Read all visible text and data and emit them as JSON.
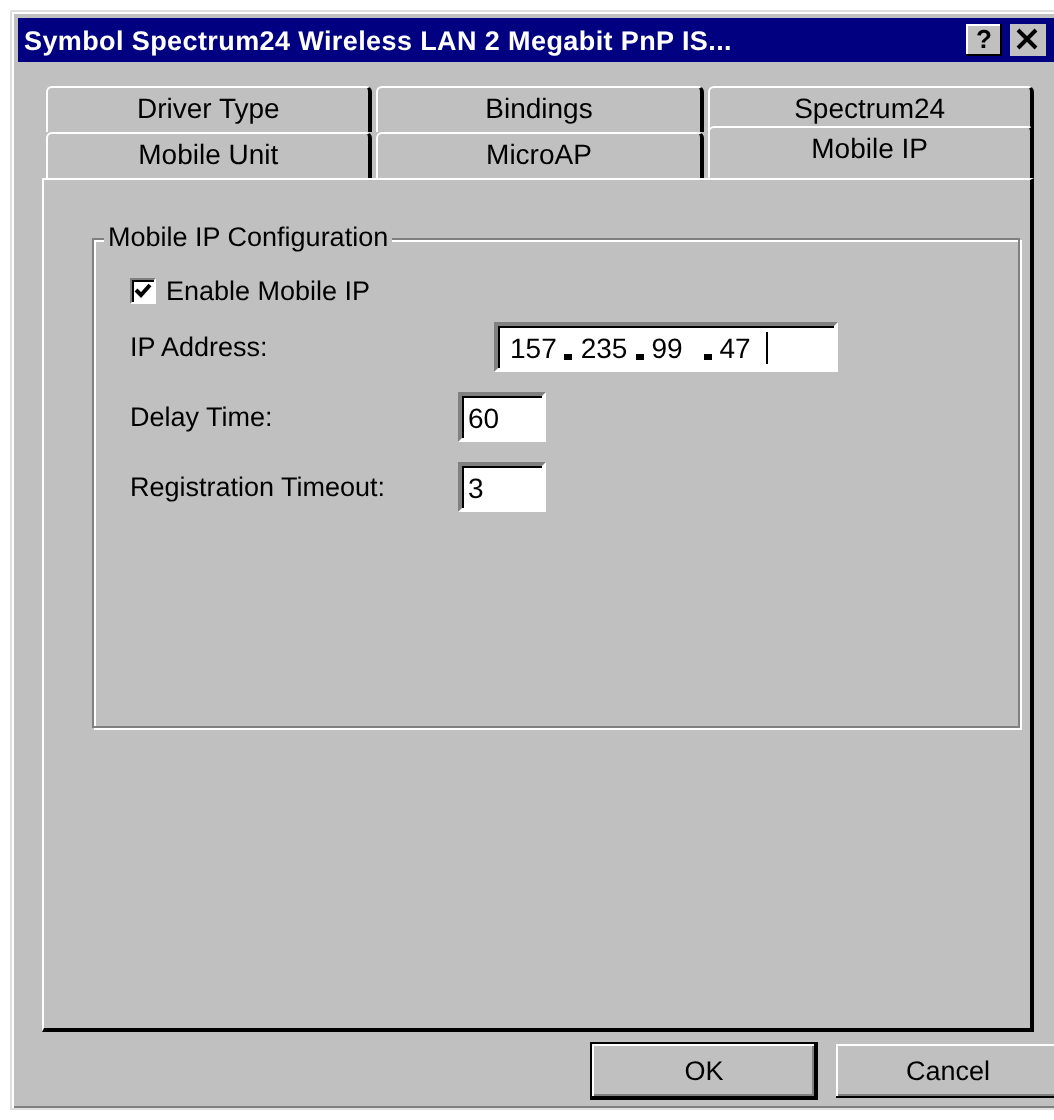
{
  "window": {
    "title": "Symbol Spectrum24 Wireless LAN 2 Megabit PnP IS...",
    "help_button": "?"
  },
  "tab_rows": [
    [
      {
        "label": "Driver Type",
        "selected": false
      },
      {
        "label": "Bindings",
        "selected": false
      },
      {
        "label": "Spectrum24",
        "selected": false
      }
    ],
    [
      {
        "label": "Mobile Unit",
        "selected": false
      },
      {
        "label": "MicroAP",
        "selected": false
      },
      {
        "label": "Mobile IP",
        "selected": true
      }
    ]
  ],
  "group": {
    "title": "Mobile IP Configuration",
    "checkbox": {
      "label": "Enable Mobile IP",
      "checked": true
    },
    "ip_address": {
      "label": "IP Address:",
      "octets": [
        "157",
        "235",
        "99",
        "47"
      ]
    },
    "fields": [
      {
        "label": "Delay Time:",
        "value": "60"
      },
      {
        "label": "Registration Timeout:",
        "value": "3"
      }
    ]
  },
  "buttons": [
    {
      "label": "OK",
      "default": true
    },
    {
      "label": "Cancel",
      "default": false
    }
  ]
}
